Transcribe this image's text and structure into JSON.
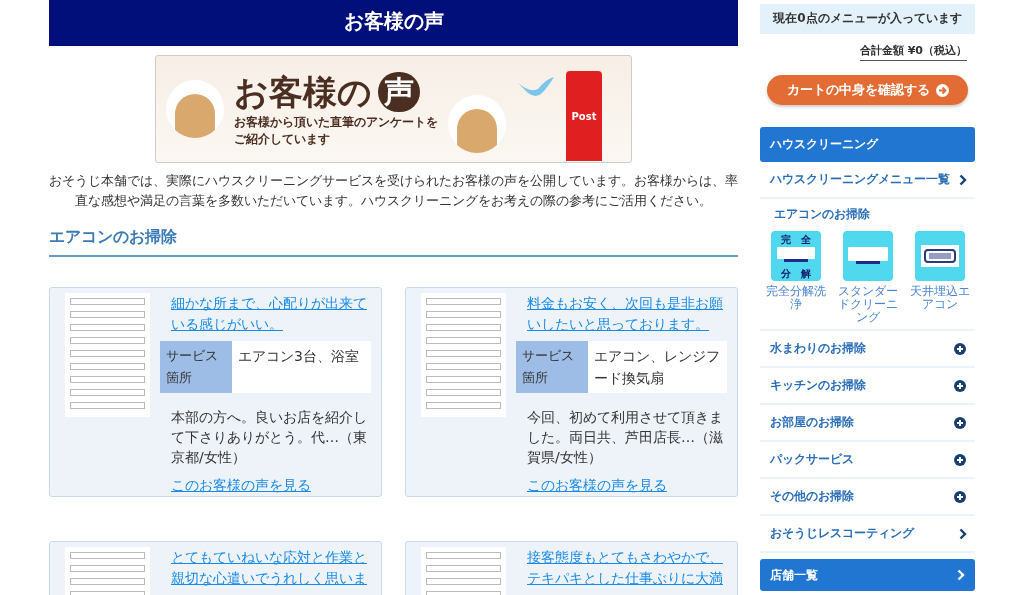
{
  "page_title": "お客様の声",
  "banner": {
    "title": "お客様の",
    "title_mark": "声",
    "subtitle_1": "お客様から頂いた直筆のアンケートを",
    "subtitle_2": "ご紹介しています",
    "post_label": "Post"
  },
  "intro": "おそうじ本舗では、実際にハウスクリーニングサービスを受けられたお客様の声を公開しています。お客様からは、率直な感想や満足の言葉を多数いただいています。ハウスクリーニングをお考えの際の参考にご活用ください。",
  "section_heading": "エアコンのお掃除",
  "reviews": [
    {
      "title": "細かな所まで、心配りが出来ている感じがいい。",
      "service_label": "サービス箇所",
      "service": "エアコン3台、浴室",
      "excerpt": "本部の方へ。良いお店を紹介して下さりありがとう。代…（東京都/女性）",
      "link": "このお客様の声を見る"
    },
    {
      "title": "料金もお安く、次回も是非お願いしたいと思っております。",
      "service_label": "サービス箇所",
      "service": "エアコン、レンジフード換気扇",
      "excerpt": "今回、初めて利用させて頂きました。両日共、芦田店長…（滋賀県/女性）",
      "link": "このお客様の声を見る"
    },
    {
      "title": "とてもていねいな応対と作業と親切な心遣いでうれしく思いま"
    },
    {
      "title": "接客態度もとてもさわやかで、テキパキとした仕事ぶりに大満"
    }
  ],
  "cart": {
    "notice": "現在0点のメニューが入っています",
    "total": "合計金額 ¥0（税込）",
    "button": "カートの中身を確認する"
  },
  "sidebar": {
    "header": "ハウスクリーニング",
    "items": [
      {
        "kind": "link",
        "label": "ハウスクリーニングメニュー一覧"
      },
      {
        "kind": "group",
        "label": "エアコンのお掃除",
        "tiles": [
          {
            "kind": "full",
            "label": "完全分解洗浄",
            "mark_1": "完",
            "mark_2": "全",
            "mark_3": "分",
            "mark_4": "解"
          },
          {
            "kind": "standard",
            "label": "スタンダードクリーニング"
          },
          {
            "kind": "ceiling",
            "label": "天井埋込エアコン"
          }
        ]
      },
      {
        "kind": "expand",
        "label": "水まわりのお掃除",
        "expanded": false
      },
      {
        "kind": "expand",
        "label": "キッチンのお掃除",
        "expanded": false
      },
      {
        "kind": "expand",
        "label": "お部屋のお掃除",
        "expanded": false
      },
      {
        "kind": "expand",
        "label": "パックサービス",
        "expanded": false
      },
      {
        "kind": "expand",
        "label": "その他のお掃除",
        "expanded": false
      },
      {
        "kind": "link",
        "label": "おそうじレスコーティング"
      }
    ],
    "footer": "店舗一覧"
  }
}
